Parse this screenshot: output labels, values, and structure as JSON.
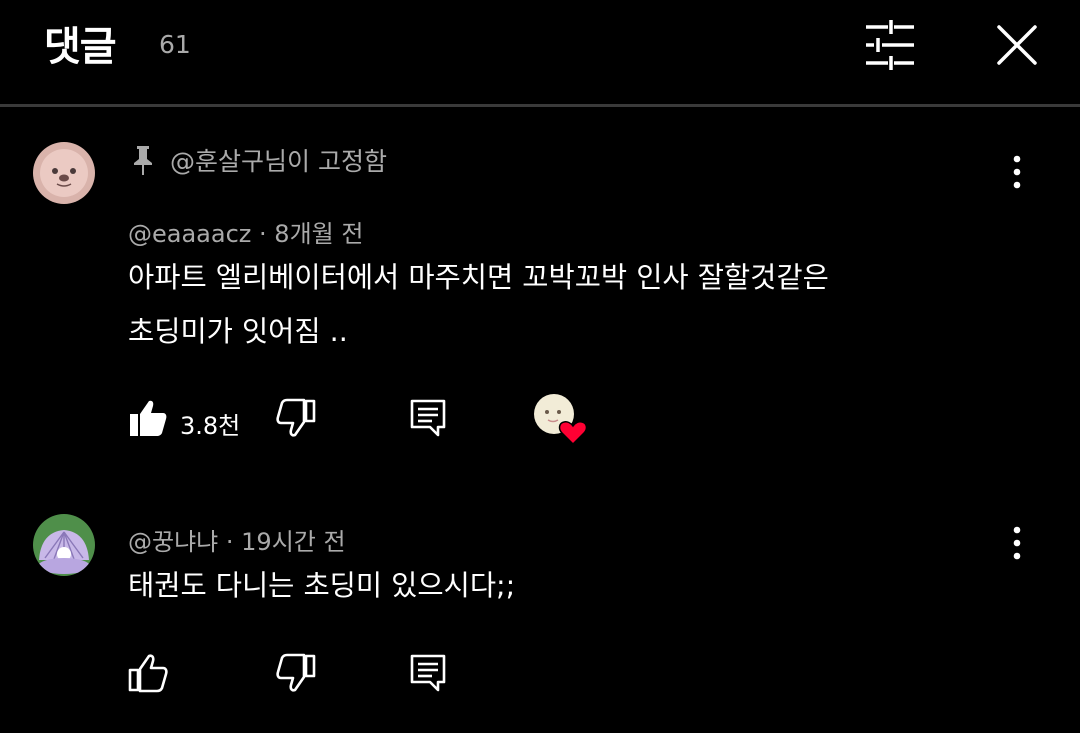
{
  "header": {
    "title": "댓글",
    "count": "61"
  },
  "icons": {
    "filter": "sliders-icon",
    "close": "close-icon",
    "pin": "pin-icon",
    "more": "more-vertical-icon",
    "like": "thumbs-up-icon",
    "dislike": "thumbs-down-icon",
    "reply": "reply-icon",
    "creator_heart": "creator-heart-icon"
  },
  "comments": [
    {
      "pinned_label": "@훈살구님이 고정함",
      "author": "@eaaaacz",
      "time": "8개월 전",
      "text": "아파트 엘리베이터에서 마주치면 꼬박꼬박 인사 잘할것같은\n초딩미가 잇어짐 ..",
      "likes": "3.8천",
      "liked": true,
      "hearted": true
    },
    {
      "author": "@꿍냐냐",
      "time": "19시간 전",
      "text": "태권도 다니는 초딩미 있으시다;;",
      "likes": "",
      "liked": false,
      "hearted": false
    }
  ],
  "colors": {
    "background": "#000000",
    "heart": "#ff0033",
    "secondary_text": "#aaaaaa"
  }
}
